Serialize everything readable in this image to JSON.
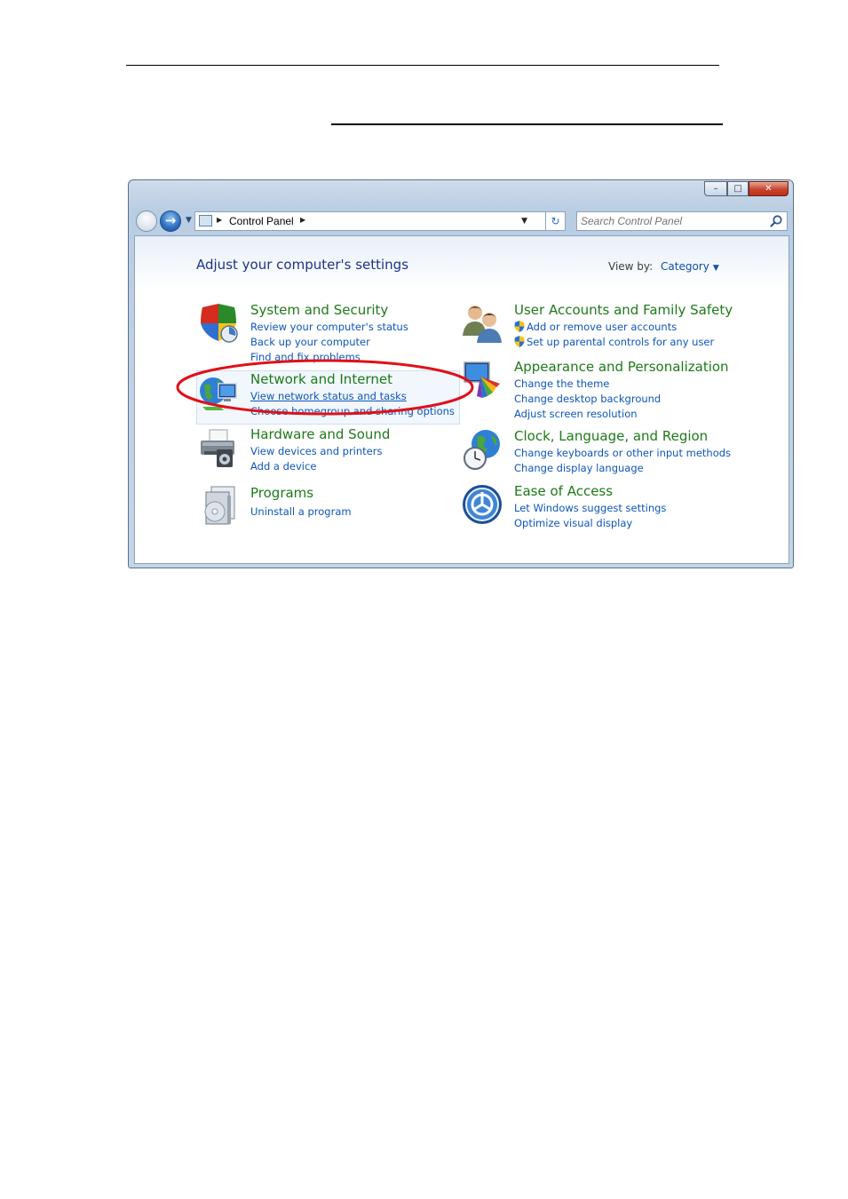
{
  "window": {
    "title": "",
    "min_glyph": "–",
    "max_glyph": "□",
    "close_glyph": "✕"
  },
  "nav": {
    "forward_glyph": "→",
    "breadcrumb": "Control Panel",
    "refresh_glyph": "↻",
    "search_placeholder": "Search Control Panel"
  },
  "content": {
    "heading": "Adjust your computer's settings",
    "view_by_label": "View by:",
    "view_by_value": "Category"
  },
  "categories": [
    {
      "title": "System and Security",
      "icon": "shield-icon",
      "links": [
        {
          "label": "Review your computer's status",
          "shield": false
        },
        {
          "label": "Back up your computer",
          "shield": false
        },
        {
          "label": "Find and fix problems",
          "shield": false
        }
      ]
    },
    {
      "title": "Network and Internet",
      "icon": "network-globe-icon",
      "links": [
        {
          "label": "View network status and tasks",
          "shield": false
        },
        {
          "label": "Choose homegroup and sharing options",
          "shield": false
        }
      ]
    },
    {
      "title": "Hardware and Sound",
      "icon": "printer-icon",
      "links": [
        {
          "label": "View devices and printers",
          "shield": false
        },
        {
          "label": "Add a device",
          "shield": false
        }
      ]
    },
    {
      "title": "Programs",
      "icon": "programs-icon",
      "links": [
        {
          "label": "Uninstall a program",
          "shield": false
        }
      ]
    },
    {
      "title": "User Accounts and Family Safety",
      "icon": "users-icon",
      "links": [
        {
          "label": "Add or remove user accounts",
          "shield": true
        },
        {
          "label": "Set up parental controls for any user",
          "shield": true
        }
      ]
    },
    {
      "title": "Appearance and Personalization",
      "icon": "appearance-icon",
      "links": [
        {
          "label": "Change the theme",
          "shield": false
        },
        {
          "label": "Change desktop background",
          "shield": false
        },
        {
          "label": "Adjust screen resolution",
          "shield": false
        }
      ]
    },
    {
      "title": "Clock, Language, and Region",
      "icon": "clock-globe-icon",
      "links": [
        {
          "label": "Change keyboards or other input methods",
          "shield": false
        },
        {
          "label": "Change display language",
          "shield": false
        }
      ]
    },
    {
      "title": "Ease of Access",
      "icon": "ease-of-access-icon",
      "links": [
        {
          "label": "Let Windows suggest settings",
          "shield": false
        },
        {
          "label": "Optimize visual display",
          "shield": false
        }
      ]
    }
  ],
  "colors": {
    "category_title": "#1d7a19",
    "link": "#0e56b8",
    "heading": "#1e3287",
    "annotation": "#e0101a"
  }
}
